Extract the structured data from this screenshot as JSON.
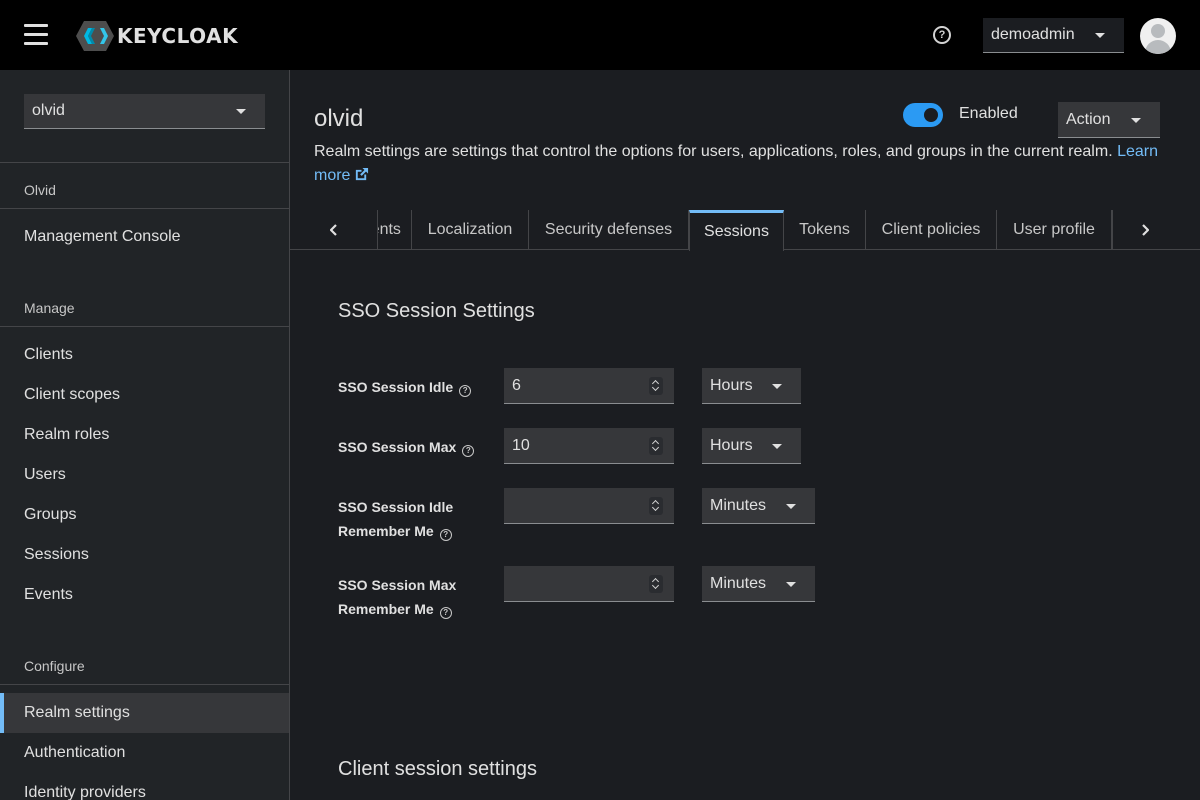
{
  "header": {
    "logo_text": "KEYCLOAK",
    "help_symbol": "?",
    "user": "demoadmin"
  },
  "sidebar": {
    "realm": "olvid",
    "realm_heading": "Olvid",
    "console_item": "Management Console",
    "manage_heading": "Manage",
    "manage_items": [
      "Clients",
      "Client scopes",
      "Realm roles",
      "Users",
      "Groups",
      "Sessions",
      "Events"
    ],
    "configure_heading": "Configure",
    "configure_items": [
      "Realm settings",
      "Authentication",
      "Identity providers"
    ],
    "active_item": "Realm settings"
  },
  "main": {
    "title": "olvid",
    "enabled_label": "Enabled",
    "enabled": true,
    "action_label": "Action",
    "description": "Realm settings are settings that control the options for users, applications, roles, and groups in the current realm.",
    "learn_more": "Learn more",
    "tabs": {
      "partial": "Events",
      "items": [
        "Localization",
        "Security defenses",
        "Sessions",
        "Tokens",
        "Client policies",
        "User profile"
      ],
      "active": "Sessions"
    },
    "sso_section": {
      "title": "SSO Session Settings",
      "fields": [
        {
          "label": "SSO Session Idle",
          "value": "6",
          "unit": "Hours"
        },
        {
          "label": "SSO Session Max",
          "value": "10",
          "unit": "Hours"
        },
        {
          "label_line1": "SSO Session Idle",
          "label_line2": "Remember Me",
          "value": "",
          "unit": "Minutes"
        },
        {
          "label_line1": "SSO Session Max",
          "label_line2": "Remember Me",
          "value": "",
          "unit": "Minutes"
        }
      ]
    },
    "client_section": {
      "title": "Client session settings"
    }
  },
  "colors": {
    "accent": "#73bcf7",
    "toggle_on": "#2b9af3",
    "header_bg": "#000000",
    "sidebar_bg": "#212427",
    "main_bg": "#1b1d21"
  }
}
